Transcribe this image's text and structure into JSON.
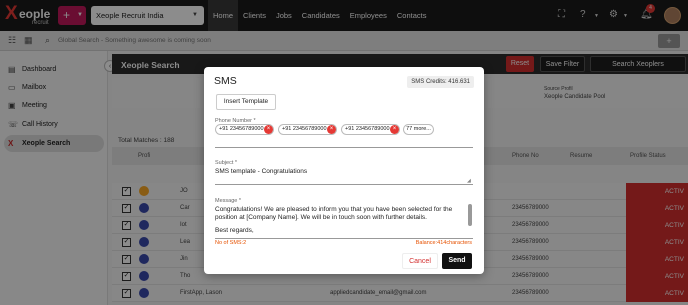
{
  "brand": {
    "logo_word": "eople",
    "logo_sub": "recruit"
  },
  "topbar": {
    "add_label": "+",
    "org": "Xeople Recruit India",
    "nav": [
      "Home",
      "Clients",
      "Jobs",
      "Candidates",
      "Employees",
      "Contacts"
    ],
    "active_nav": "Home",
    "notification_count": "4"
  },
  "searchbar": {
    "placeholder": "Global Search - Something awesome is coming soon",
    "add_label": "+"
  },
  "sidebar": {
    "items": [
      {
        "label": "Dashboard",
        "icon": "dashboard-icon"
      },
      {
        "label": "Mailbox",
        "icon": "mailbox-icon"
      },
      {
        "label": "Meeting",
        "icon": "meeting-icon"
      },
      {
        "label": "Call History",
        "icon": "call-history-icon"
      },
      {
        "label": "Xeople Search",
        "icon": "xeople-search-icon"
      }
    ],
    "active": "Xeople Search"
  },
  "content": {
    "title": "Xeople Search",
    "reset_label": "Reset",
    "save_filter_label": "Save Filter",
    "search_label": "Search Xeoplers",
    "source_profile_label": "Source Profil",
    "source_profile_value": "Xeople Candidate Pool",
    "total_matches": "Total Matches : 188",
    "columns": [
      "Profi",
      "Phone No",
      "Resume",
      "Profile Status"
    ],
    "rows": [
      {
        "name": "JO",
        "phone": "",
        "status": "ACTIV"
      },
      {
        "name": "Car",
        "phone": "23456789000",
        "status": "ACTIV"
      },
      {
        "name": "Iot",
        "phone": "23456789000",
        "status": "ACTIV"
      },
      {
        "name": "Lea",
        "phone": "23456789000",
        "status": "ACTIV"
      },
      {
        "name": "Jin",
        "phone": "23456789000",
        "status": "ACTIV"
      },
      {
        "name": "Tho",
        "phone": "23456789000",
        "status": "ACTIV"
      },
      {
        "name": "FirstApp, Lason",
        "phone": "23456789000",
        "status": "ACTIV"
      }
    ],
    "row_email": "appliedcandidate_email@gmail.com"
  },
  "modal": {
    "title": "SMS",
    "credits": "SMS Credits: 416.631",
    "insert_template_label": "Insert Template",
    "phone_label": "Phone Number *",
    "phones": [
      "+91 23456789000",
      "+91 23456789000",
      "+91 23456789000"
    ],
    "more_label": "77 more...",
    "subject_label": "Subject *",
    "subject_value": "SMS template - Congratulations",
    "message_label": "Message *",
    "message_value": "Congratulations! We are pleased to inform you that you have been selected for the position at [Company Name]. We will be in touch soon with further details.",
    "message_closing": "Best regards,",
    "sms_count": "No of SMS:2",
    "balance": "Balance:414characters",
    "cancel_label": "Cancel",
    "send_label": "Send"
  },
  "colors": {
    "accent": "#c2185b",
    "topbar": "#1b1b1b",
    "danger": "#e53935",
    "status_active": "#d32f2f",
    "warning_text": "#e65100"
  }
}
